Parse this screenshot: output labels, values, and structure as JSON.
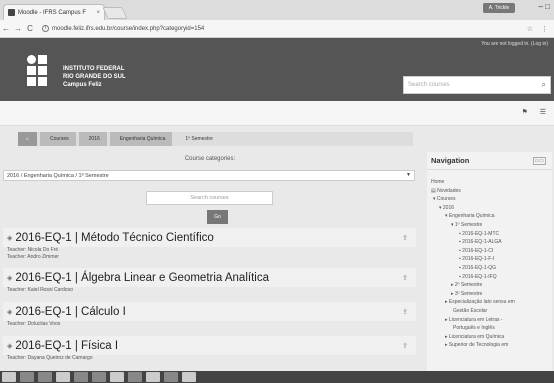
{
  "browser": {
    "tab_title": "Moodle - IFRS Campus F",
    "tab_close": "×",
    "user_badge": "A. Trickle",
    "window_controls": "–  □",
    "url": "moodle.feliz.ifrs.edu.br/course/index.php?categoryid=154",
    "nav_back": "←",
    "nav_forward": "→",
    "nav_reload": "C",
    "star": "☆",
    "menu": "⋮"
  },
  "header": {
    "login_status": "You are not logged in. (Log in)",
    "institution_line1": "INSTITUTO FEDERAL",
    "institution_line2": "RIO GRANDE DO SUL",
    "institution_line3": "Campus Feliz",
    "search_placeholder": "Search courses"
  },
  "breadcrumb": [
    "Courses",
    "2016",
    "Engenharia Química",
    "1º Semestre"
  ],
  "main": {
    "categories_label": "Course categories:",
    "selected_category": "2016 / Engenharia Química / 1º Semestre",
    "search_placeholder": "Search courses",
    "go_label": "Go"
  },
  "courses": [
    {
      "title": "2016-EQ-1 | Método Técnico Científico",
      "teachers": [
        "Teacher: Nicola Do Fré",
        "Teacher: Andro Zimmer"
      ]
    },
    {
      "title": "2016-EQ-1 | Álgebra Linear e Geometria Analítica",
      "teachers": [
        "Teacher: Kaiel Rossi Cardoso"
      ]
    },
    {
      "title": "2016-EQ-1 | Cálculo I",
      "teachers": [
        "Teacher: Dolucilas Voos"
      ]
    },
    {
      "title": "2016-EQ-1 | Física I",
      "teachers": [
        "Teacher: Dayana Queiroz de Camargo"
      ]
    }
  ],
  "navigation": {
    "title": "Navigation",
    "items": [
      "Home",
      "Novidades",
      "Courses",
      "2016",
      "Engenharia Química",
      "1º Semestre",
      "2016-EQ-1-MTC",
      "2016-EQ-1-ALGA",
      "2016-EQ-1-CI",
      "2016-EQ-1-F-I",
      "2016-EQ-1-QG",
      "2016-EQ-1-IFQ",
      "2º Semestre",
      "3º Semestre",
      "Especialização lato sensu em",
      "Gestão Escolar",
      "Licenciatura em Letras -",
      "Português e Inglês",
      "Licenciatura em Química",
      "Superior de Tecnologia em"
    ]
  }
}
